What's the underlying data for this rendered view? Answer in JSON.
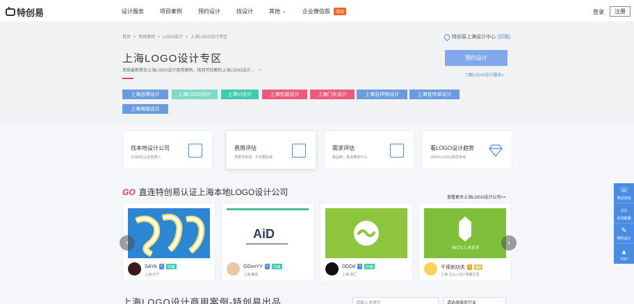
{
  "nav": {
    "logo": "特创易",
    "items": [
      "设计服务",
      "项目案例",
      "预约设计",
      "找设计",
      "其他",
      "企业微信版"
    ],
    "badge": "活动",
    "login": "登录",
    "register": "注册"
  },
  "hero": {
    "breadcrumb": [
      "首页",
      ">",
      "项目案例",
      ">",
      "LOGO设计",
      ">",
      "上海LOGO设计专区"
    ],
    "location": "特创易上海设计中心",
    "switch": "[切换]",
    "title": "上海LOGO设计专区",
    "desc": "发现最新质优上海LOGO设计商用案例，找到可信赖的上海LOGO设计...",
    "book_btn": "预约设计",
    "learn_link": "了解LOGO设计服务>",
    "tags": [
      {
        "label": "上海品牌设计",
        "color": "#6a9bdf"
      },
      {
        "label": "上海LOGO设计",
        "color": "#7ddbc3"
      },
      {
        "label": "上海VI设计",
        "color": "#3ccdb0"
      },
      {
        "label": "上海包装设计",
        "color": "#ef5a7c"
      },
      {
        "label": "上海门头设计",
        "color": "#ef5a7c"
      },
      {
        "label": "上海吉祥物设计",
        "color": "#6a9bdf"
      },
      {
        "label": "上海宣传单设计",
        "color": "#6a9bdf"
      },
      {
        "label": "上海海报设计",
        "color": "#6a9bdf"
      }
    ]
  },
  "features": [
    {
      "title": "找本地设计公司",
      "sub": "11425位认证创意人"
    },
    {
      "title": "费用评估",
      "sub": "预算早知道，不花冤枉钱"
    },
    {
      "title": "需求评估",
      "sub": "做品牌，真该要做什么"
    },
    {
      "title": "看LOGO设计趋势",
      "sub": "30000+LOGO供您参考"
    }
  ],
  "section": {
    "go": "GO",
    "title": "直连特创易认证上海本地LOGO设计公司",
    "more": "查看更多上海LOGO设计公司>>"
  },
  "companies": [
    {
      "name": "SAYA",
      "level": "V",
      "years": "20级",
      "loc": "上海 长宁",
      "img_color": "#2c86d4"
    },
    {
      "name": "GGxnYY",
      "level": "V",
      "years": "31级",
      "loc": "上海 静安",
      "img_color": "#ffffff",
      "img_text": "AiD"
    },
    {
      "name": "DDDd",
      "level": "V",
      "years": "23级",
      "loc": "上海 徐汇",
      "img_color": "#8dc53e"
    },
    {
      "name": "千视创功夫",
      "level": "V",
      "years": "8级",
      "loc": "上海 宝山 | 设计突破生活",
      "img_color": "#7fbf3a",
      "img_text": "MOLLREE"
    }
  ],
  "bottom": {
    "title": "上海LOGO设计商用案例-特创易出品",
    "search_placeholder": "请输入关键字",
    "select": "请选择服务行业"
  },
  "sidebar": [
    "电话咨询",
    "在线客服",
    "预约设计",
    "TOP"
  ]
}
